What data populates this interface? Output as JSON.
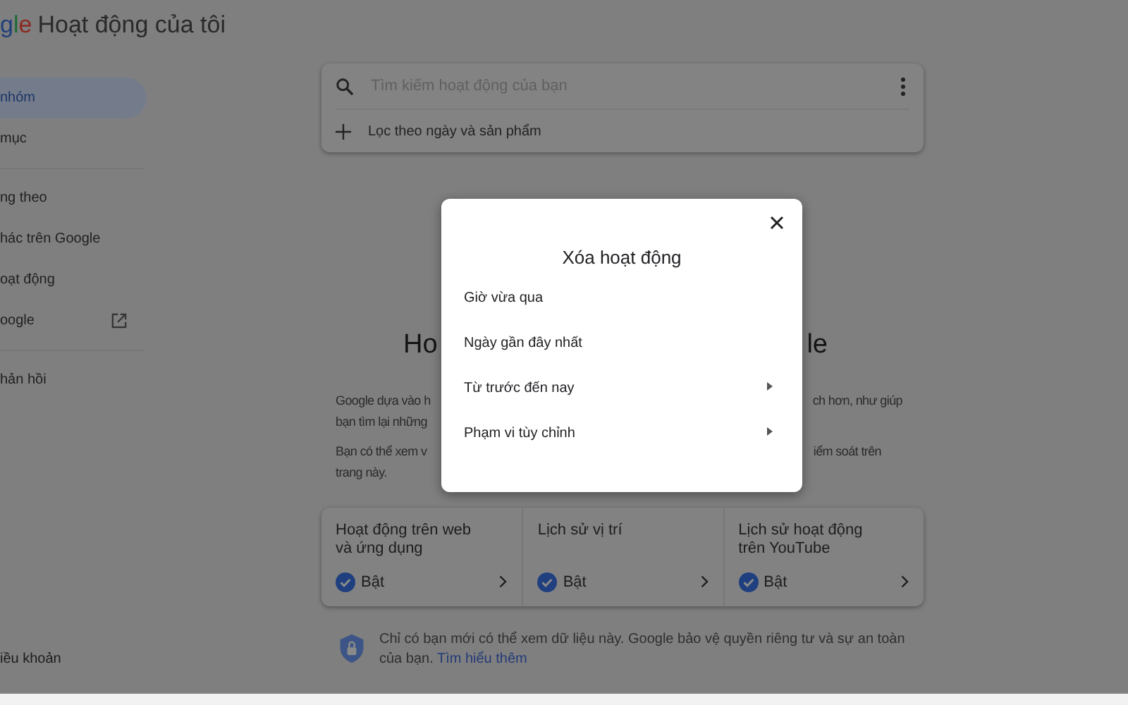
{
  "header": {
    "logo": "gle",
    "title": "Hoạt động của tôi"
  },
  "sidebar": {
    "groups": [
      [
        {
          "label": "nhóm",
          "selected": true,
          "external": false
        },
        {
          "label": "mục",
          "selected": false,
          "external": false
        }
      ],
      [
        {
          "label": "ng theo",
          "selected": false,
          "external": false
        },
        {
          "label": "hác trên Google",
          "selected": false,
          "external": false
        },
        {
          "label": "oạt động",
          "selected": false,
          "external": false
        },
        {
          "label": "oogle",
          "selected": false,
          "external": true
        }
      ],
      [
        {
          "label": "hản hồi",
          "selected": false,
          "external": false
        }
      ]
    ],
    "footer_link": "iều khoản"
  },
  "search": {
    "placeholder": "Tìm kiếm hoạt động của bạn",
    "filter": "Lọc theo ngày và sản phẩm"
  },
  "heading_fragments": [
    "Ho",
    "le"
  ],
  "paragraphs": [
    {
      "left_lines": [
        "Google dựa vào h",
        "bạn tìm lại những"
      ],
      "right_lines": [
        "ch hơn, như giúp"
      ]
    },
    {
      "left_lines": [
        "Bạn có thể xem v",
        "trang này."
      ],
      "right_lines": [
        "iểm soát trên"
      ]
    }
  ],
  "cards": [
    {
      "title": "Hoạt động trên web và ứng dụng",
      "status": "Bật",
      "on": true
    },
    {
      "title": "Lịch sử vị trí",
      "status": "Bật",
      "on": true
    },
    {
      "title": "Lịch sử hoạt động trên YouTube",
      "status": "Bật",
      "on": true
    }
  ],
  "privacy_note": {
    "text": "Chỉ có bạn mới có thể xem dữ liệu này. Google bảo vệ quyền riêng tư và sự an toàn của bạn.",
    "link": "Tìm hiểu thêm"
  },
  "dialog": {
    "title": "Xóa hoạt động",
    "options": [
      {
        "label": "Giờ vừa qua",
        "has_submenu": false
      },
      {
        "label": "Ngày gần đây nhất",
        "has_submenu": false
      },
      {
        "label": "Từ trước đến nay",
        "has_submenu": true
      },
      {
        "label": "Phạm vi tùy chỉnh",
        "has_submenu": true
      }
    ]
  }
}
